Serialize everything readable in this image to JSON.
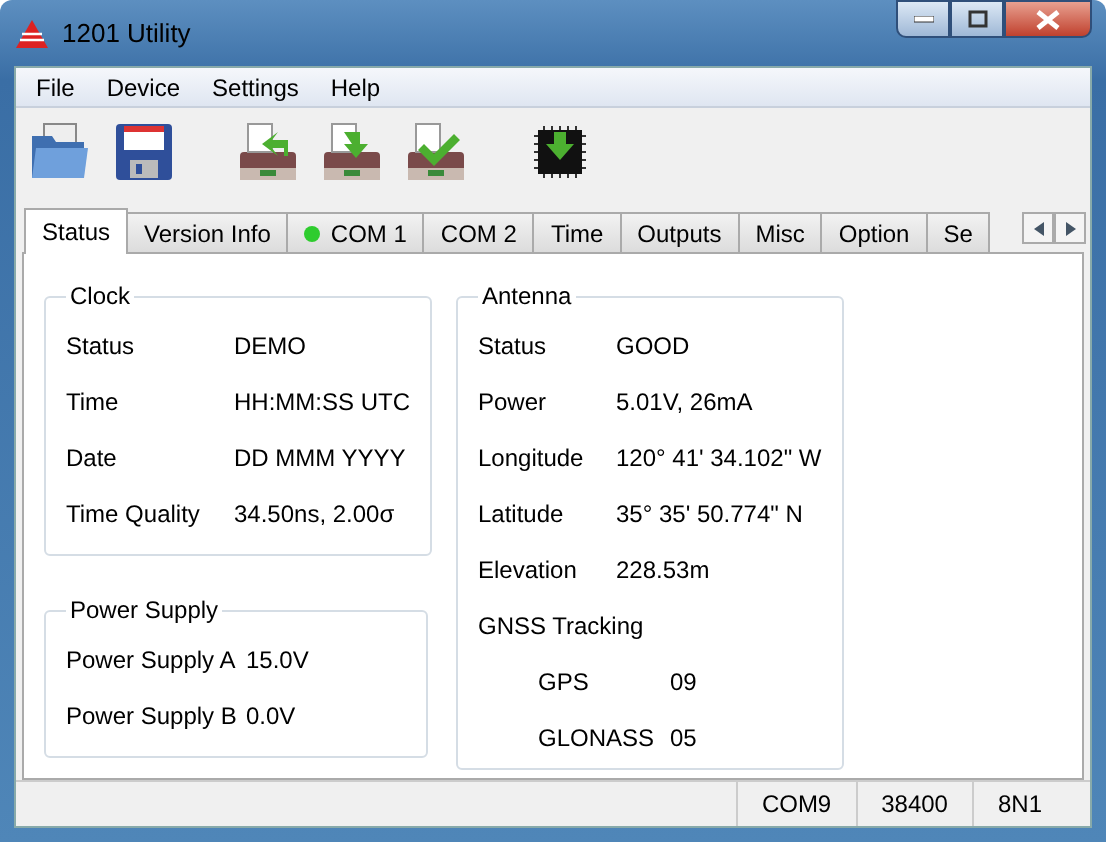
{
  "window": {
    "title": "1201 Utility"
  },
  "menu": [
    "File",
    "Device",
    "Settings",
    "Help"
  ],
  "toolbar": [
    {
      "kind": "open"
    },
    {
      "kind": "save"
    },
    {
      "kind": "read"
    },
    {
      "kind": "write"
    },
    {
      "kind": "verify"
    },
    {
      "kind": "firmware"
    }
  ],
  "tabs": [
    {
      "label": "Status",
      "selected": true
    },
    {
      "label": "Version Info",
      "selected": false
    },
    {
      "label": "COM 1",
      "selected": false,
      "color": "#2ecc2e"
    },
    {
      "label": "COM 2",
      "selected": false
    },
    {
      "label": "Time",
      "selected": false
    },
    {
      "label": "Outputs",
      "selected": false
    },
    {
      "label": "Misc",
      "selected": false
    },
    {
      "label": "Option",
      "selected": false
    },
    {
      "label": "Se",
      "selected": false
    }
  ],
  "clock": {
    "title": "Clock",
    "rows": [
      {
        "label": "Status",
        "value": "DEMO"
      },
      {
        "label": "Time",
        "value": "HH:MM:SS UTC"
      },
      {
        "label": "Date",
        "value": "DD MMM YYYY"
      },
      {
        "label": "Time Quality",
        "value": "34.50ns, 2.00σ"
      }
    ]
  },
  "power_supply": {
    "title": "Power Supply",
    "rows": [
      {
        "label": "Power Supply A",
        "value": "15.0V"
      },
      {
        "label": "Power Supply B",
        "value": "0.0V"
      }
    ]
  },
  "antenna": {
    "title": "Antenna",
    "rows": [
      {
        "label": "Status",
        "value": "GOOD"
      },
      {
        "label": "Power",
        "value": "5.01V, 26mA"
      },
      {
        "label": "Longitude",
        "value": "120° 41' 34.102\" W"
      },
      {
        "label": "Latitude",
        "value": "35° 35' 50.774\" N"
      },
      {
        "label": "Elevation",
        "value": "228.53m"
      }
    ],
    "tracking": {
      "title": "GNSS Tracking",
      "rows": [
        {
          "label": "GPS",
          "value": "09"
        },
        {
          "label": "GLONASS",
          "value": "05"
        }
      ]
    }
  },
  "status_bar": [
    "COM9",
    "38400",
    "8N1"
  ]
}
